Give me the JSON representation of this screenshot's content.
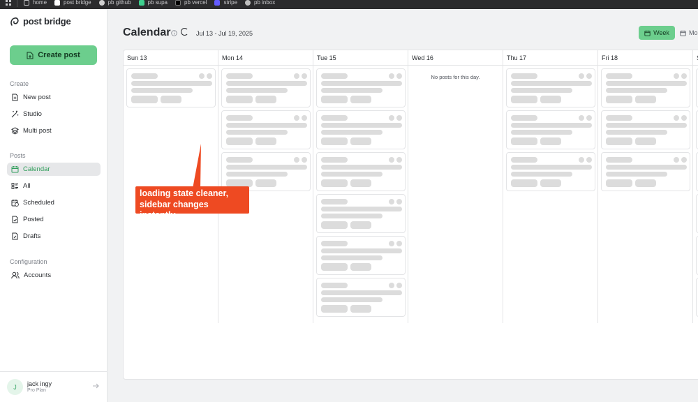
{
  "bookmarks": [
    {
      "label": "home",
      "color": "#e7e7e7"
    },
    {
      "label": "post bridge",
      "color": "#ffffff"
    },
    {
      "label": "pb github",
      "color": "#d0d0d0"
    },
    {
      "label": "pb supa",
      "color": "#3ecf8e"
    },
    {
      "label": "pb vercel",
      "color": "#ffffff"
    },
    {
      "label": "stripe",
      "color": "#635bff"
    },
    {
      "label": "pb inbox",
      "color": "#bfbfbf"
    }
  ],
  "brand": {
    "name": "post bridge"
  },
  "sidebar": {
    "create_button": "Create post",
    "sections": {
      "create": "Create",
      "posts": "Posts",
      "configuration": "Configuration"
    },
    "create_items": [
      {
        "label": "New post",
        "icon": "new-post-icon"
      },
      {
        "label": "Studio",
        "icon": "wand-icon"
      },
      {
        "label": "Multi post",
        "icon": "layers-icon"
      }
    ],
    "post_items": [
      {
        "label": "Calendar",
        "icon": "calendar-icon",
        "active": true
      },
      {
        "label": "All",
        "icon": "list-icon"
      },
      {
        "label": "Scheduled",
        "icon": "clock-calendar-icon"
      },
      {
        "label": "Posted",
        "icon": "check-file-icon"
      },
      {
        "label": "Drafts",
        "icon": "draft-icon"
      }
    ],
    "config_items": [
      {
        "label": "Accounts",
        "icon": "users-icon"
      }
    ],
    "user": {
      "initial": "J",
      "name": "jack ingy",
      "plan": "Pro Plan"
    }
  },
  "header": {
    "title": "Calendar",
    "date_range": "Jul 13 - Jul 19, 2025",
    "view_week": "Week",
    "view_month": "Mo"
  },
  "calendar": {
    "days": [
      {
        "label": "Sun 13",
        "skeleton_cards": 1
      },
      {
        "label": "Mon 14",
        "skeleton_cards": 3
      },
      {
        "label": "Tue 15",
        "skeleton_cards": 6
      },
      {
        "label": "Wed 16",
        "skeleton_cards": 0,
        "empty_text": "No posts for this day."
      },
      {
        "label": "Thu 17",
        "skeleton_cards": 3
      },
      {
        "label": "Fri 18",
        "skeleton_cards": 3
      },
      {
        "label": "S",
        "skeleton_cards": 6
      }
    ]
  },
  "annotation": {
    "line1": "loading state cleaner,",
    "line2": "sidebar changes instantly"
  },
  "colors": {
    "accent": "#6cce8d",
    "active_text": "#2f9e5a",
    "callout": "#ee4a22",
    "skeleton": "#dcdcdc"
  }
}
